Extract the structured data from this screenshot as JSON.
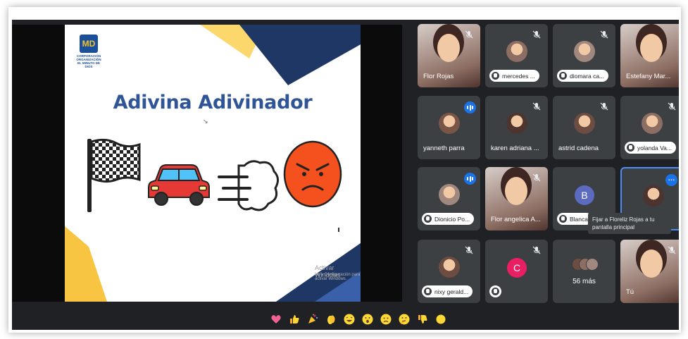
{
  "presentation": {
    "logo_initials": "MD",
    "logo_text": "CORPORACIÓN ORGANIZACIÓN EL MINUTO DE DIOS",
    "slide_title": "Adivina Adivinador",
    "watermark_title": "Activar Windows",
    "watermark_sub": "Ve a Configuración para activar Windows.",
    "emoji_icons": [
      "checkered-flag-icon",
      "red-car-icon",
      "dashing-away-icon",
      "angry-face-icon"
    ]
  },
  "participants": [
    {
      "name": "Flor Rojas",
      "style": "video",
      "status": "mic-off"
    },
    {
      "name": "mercedes ...",
      "style": "pill",
      "status": "mic-off"
    },
    {
      "name": "diomara ca...",
      "style": "pill",
      "status": "mic-off"
    },
    {
      "name": "Estefany Mar...",
      "style": "video",
      "status": "none"
    },
    {
      "name": "yanneth parra",
      "style": "label",
      "status": "speaking"
    },
    {
      "name": "karen adriana ...",
      "style": "label",
      "status": "mic-off"
    },
    {
      "name": "astrid cadena",
      "style": "label",
      "status": "mic-off"
    },
    {
      "name": "yolanda Va...",
      "style": "pill",
      "status": "mic-off"
    },
    {
      "name": "Dionicio Po...",
      "style": "pill",
      "status": "speaking"
    },
    {
      "name": "Flor angelica A...",
      "style": "video",
      "status": "mic-off"
    },
    {
      "name": "Blanca",
      "style": "pill",
      "status": "none",
      "initial": "B"
    },
    {
      "name": "",
      "style": "active",
      "status": "more"
    },
    {
      "name": "nixy gerald...",
      "style": "pill",
      "status": "mic-off"
    },
    {
      "name": "",
      "style": "pill-empty",
      "status": "mic-off",
      "initial": "C"
    },
    {
      "name": "56 más",
      "style": "more",
      "status": "none"
    },
    {
      "name": "Tú",
      "style": "video",
      "status": "mic-off"
    }
  ],
  "tooltip": "Fijar a Floreliz Rojas a tu pantalla principal",
  "reactions": [
    "sparkling-heart-icon",
    "thumbs-up-icon",
    "party-popper-icon",
    "clapping-hands-icon",
    "laughing-face-icon",
    "surprised-face-icon",
    "sad-face-icon",
    "thinking-face-icon",
    "thumbs-down-icon",
    "more-reactions-icon"
  ],
  "colors": {
    "meet_bg": "#202124",
    "tile_bg": "#3c4043",
    "accent_blue": "#1a73e8",
    "slide_title": "#2f5597",
    "avatar_B": "#5c6bc0",
    "avatar_C": "#e91e63"
  }
}
